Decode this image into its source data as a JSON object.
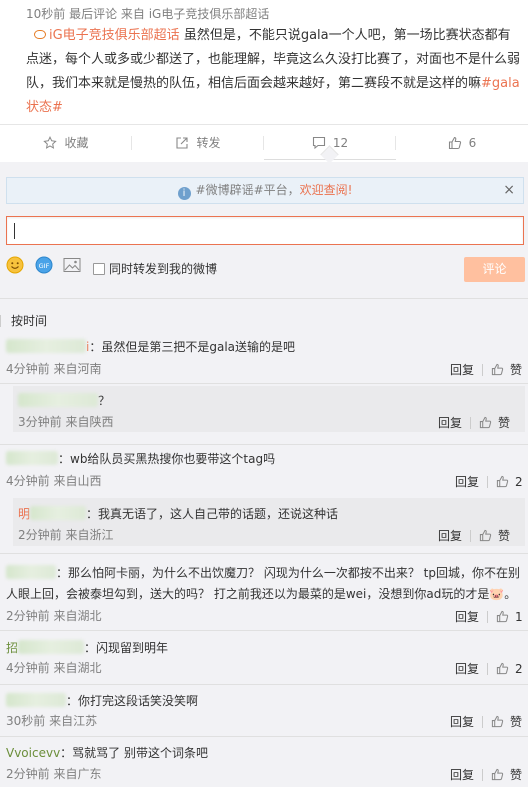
{
  "post": {
    "meta": "10秒前 最后评论 来自 iG电子竞技俱乐部超话",
    "topic": "iG电子竞技俱乐部超话",
    "body": "虽然但是，不能只说gala一个人吧，第一场比赛状态都有点迷，每个人或多或少都送了，也能理解，毕竟这么久没打比赛了，对面也不是什么弱队，我们本来就是慢热的队伍，相信后面会越来越好，第二赛段不就是这样的嘛",
    "hashtag": "#gala状态#"
  },
  "actions": {
    "collect": "收藏",
    "forward": "转发",
    "comment_count": "12",
    "like_count": "6"
  },
  "notice": {
    "text_prefix": "#微博辟谣#平台，",
    "text_highlight": "欢迎查阅!",
    "close": "×"
  },
  "composer": {
    "forward_label": "同时转发到我的微博",
    "submit": "评论"
  },
  "sort_label": "按时间",
  "comments": [
    {
      "name": "i",
      "text": "：虽然但是第三把不是gala送输的是吧",
      "meta": "4分钟前 来自河南",
      "reply": "回复",
      "likes": "赞"
    },
    {
      "name": "",
      "text": "？",
      "meta": "3分钟前 来自陕西",
      "reply": "回复",
      "likes": "赞"
    },
    {
      "name": "",
      "text": "：wb给队员买黑热搜你也要带这个tag吗",
      "meta": "4分钟前 来自山西",
      "reply": "回复",
      "likes": "2"
    },
    {
      "name": "明",
      "text": "：我真无语了，这人自己带的话题，还说这种话",
      "meta": "2分钟前 来自浙江",
      "reply": "回复",
      "likes": "赞"
    },
    {
      "name": "",
      "text": "：那么怕阿卡丽，为什么不出饮魔刀？ 闪现为什么一次都按不出来？ tp回城，你不在别",
      "text2": "人眼上回，会被泰坦勾到，送大的吗？ 打之前我还以为最菜的是wei，没想到你ad玩的才是",
      "meta": "2分钟前 来自湖北",
      "reply": "回复",
      "likes": "1"
    },
    {
      "name": "招",
      "text": "：闪现留到明年",
      "meta": "4分钟前 来自湖北",
      "reply": "回复",
      "likes": "2"
    },
    {
      "name": "",
      "text": "：你打完这段话笑没笑啊",
      "meta": "30秒前 来自江苏",
      "reply": "回复",
      "likes": "赞"
    },
    {
      "name": "Vvoicevv",
      "text": "：骂就骂了 别带这个词条吧",
      "meta": "2分钟前 来自广东",
      "reply": "回复",
      "likes": "赞"
    }
  ]
}
